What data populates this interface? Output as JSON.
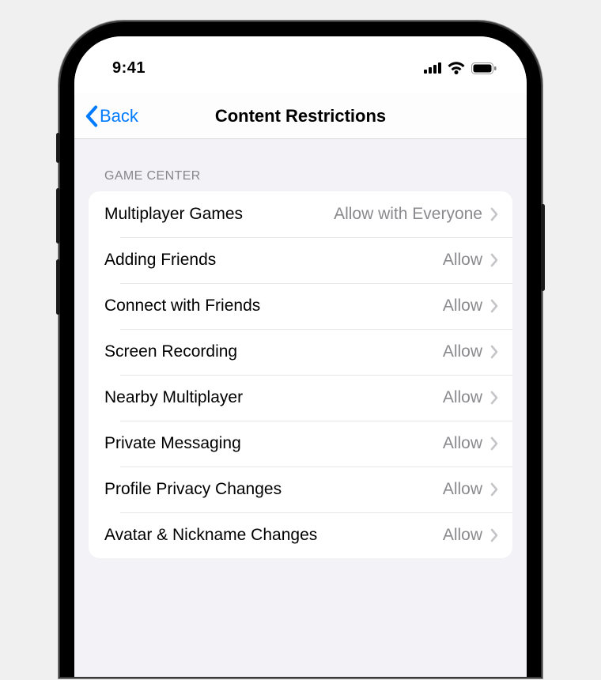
{
  "status": {
    "time": "9:41"
  },
  "nav": {
    "back_label": "Back",
    "title": "Content Restrictions"
  },
  "section": {
    "header": "Game Center"
  },
  "rows": [
    {
      "label": "Multiplayer Games",
      "value": "Allow with Everyone"
    },
    {
      "label": "Adding Friends",
      "value": "Allow"
    },
    {
      "label": "Connect with Friends",
      "value": "Allow"
    },
    {
      "label": "Screen Recording",
      "value": "Allow"
    },
    {
      "label": "Nearby Multiplayer",
      "value": "Allow"
    },
    {
      "label": "Private Messaging",
      "value": "Allow"
    },
    {
      "label": "Profile Privacy Changes",
      "value": "Allow"
    },
    {
      "label": "Avatar & Nickname Changes",
      "value": "Allow"
    }
  ]
}
